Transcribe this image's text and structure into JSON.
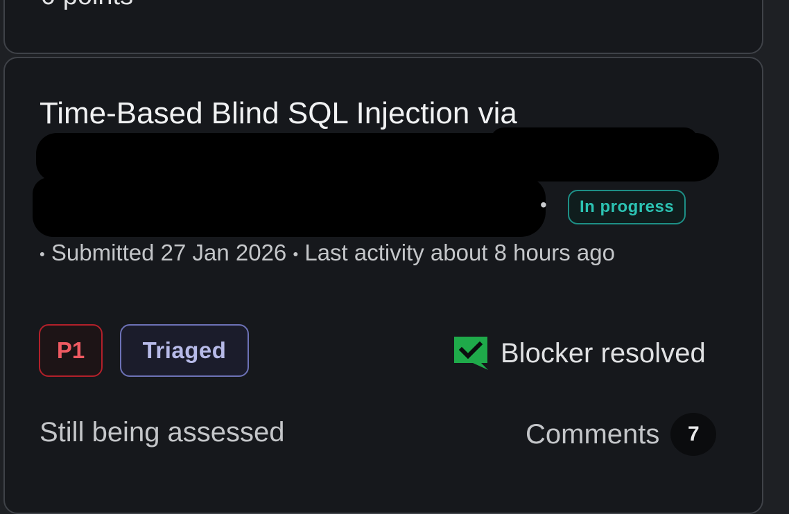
{
  "previous_card": {
    "points_text": "0 points"
  },
  "report": {
    "title": "Time-Based Blind SQL Injection via",
    "status": "In progress",
    "separator": "•",
    "meta": {
      "submitted": "Submitted 27 Jan 2026",
      "last_activity": "Last activity about 8 hours ago"
    },
    "priority": "P1",
    "state": "Triaged",
    "blocker": {
      "label": "Blocker resolved",
      "icon": "chat-check-icon",
      "color": "#1faa4a"
    },
    "reward_status": "Still being assessed",
    "comments": {
      "label": "Comments",
      "count": "7"
    }
  }
}
